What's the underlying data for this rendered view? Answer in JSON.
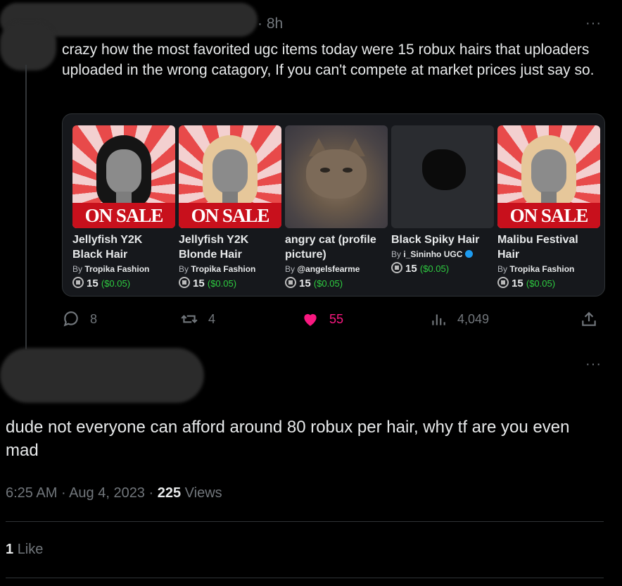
{
  "tweet": {
    "time": "· 8h",
    "more": "···",
    "text": "crazy how the most favorited ugc items today were 15 robux hairs that uploaders uploaded in the wrong catagory, If you can't compete at market prices just say so.",
    "card_items": [
      {
        "name": "Jellyfish Y2K Black Hair",
        "by": "Tropika Fashion",
        "price": "15",
        "usd": "($0.05)",
        "banner": "ON SALE",
        "thumb": "black-hair"
      },
      {
        "name": "Jellyfish Y2K Blonde Hair",
        "by": "Tropika Fashion",
        "price": "15",
        "usd": "($0.05)",
        "banner": "ON SALE",
        "thumb": "blonde-hair"
      },
      {
        "name": "angry cat (profile picture)",
        "by": "@angelsfearme",
        "price": "15",
        "usd": "($0.05)",
        "thumb": "cat"
      },
      {
        "name": "Black Spiky Hair",
        "by": "i_Sininho UGC",
        "price": "15",
        "usd": "($0.05)",
        "thumb": "spiky-hair",
        "verified": true
      },
      {
        "name": "Malibu Festival Hair",
        "by": "Tropika Fashion",
        "price": "15",
        "usd": "($0.05)",
        "banner": "ON SALE",
        "thumb": "blonde-hair"
      }
    ],
    "by_prefix": "By",
    "actions": {
      "replies": "8",
      "retweets": "4",
      "likes": "55",
      "views": "4,049"
    }
  },
  "reply": {
    "more": "···",
    "text": "dude not everyone can afford around 80 robux per hair, why tf are you even mad",
    "time": "6:25 AM",
    "date": "Aug 4, 2023",
    "views_count": "225",
    "views_label": "Views",
    "likes_count": "1",
    "likes_label": "Like"
  },
  "colors": {
    "background": "#000000",
    "text": "#e7e9ea",
    "muted": "#71767b",
    "like": "#f91880",
    "usd": "#2ecc40"
  }
}
